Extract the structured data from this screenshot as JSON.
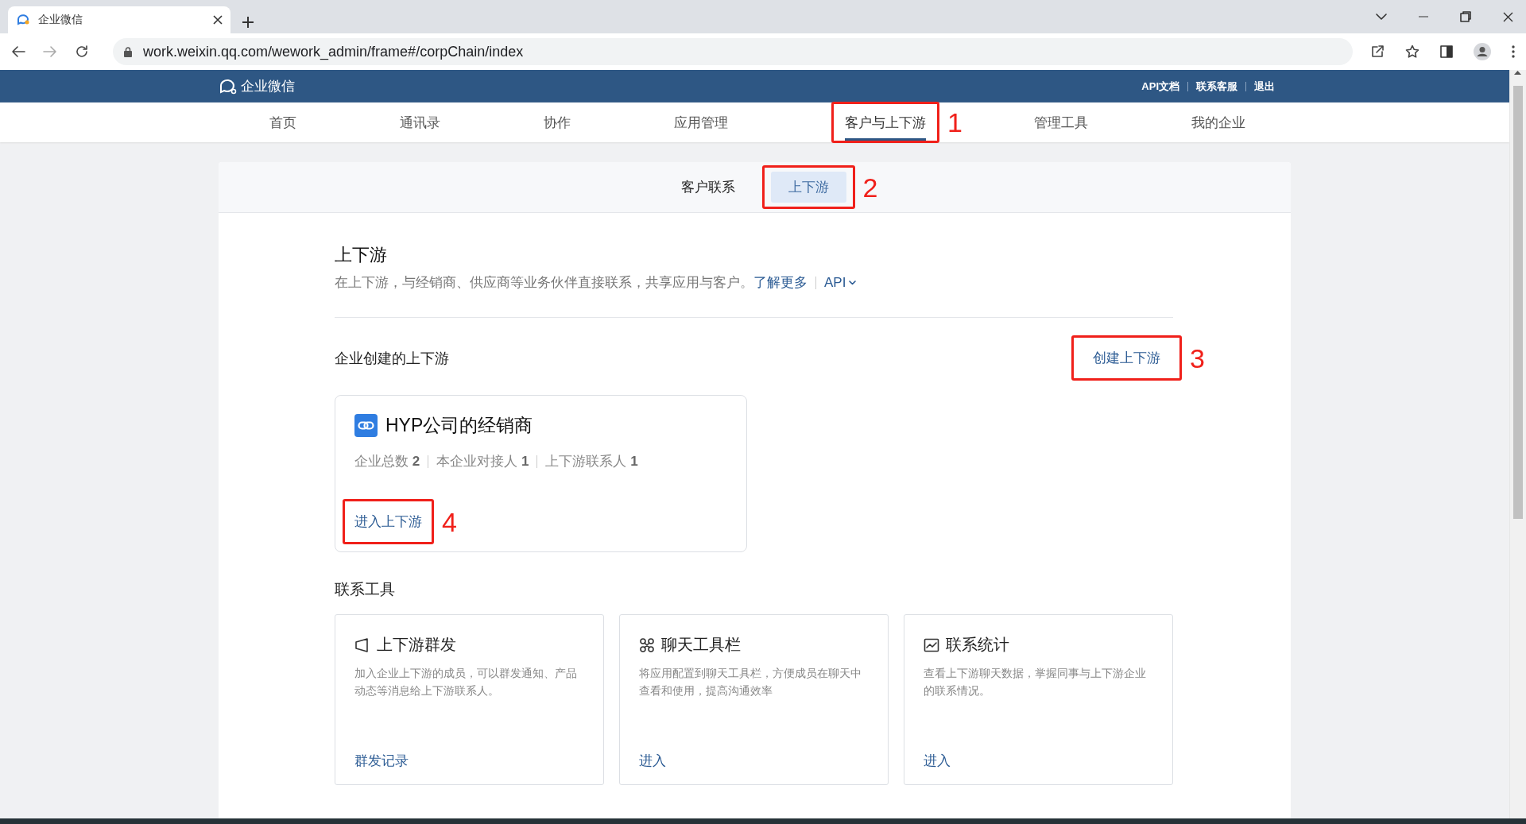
{
  "browser": {
    "tab_title": "企业微信",
    "url": "work.weixin.qq.com/wework_admin/frame#/corpChain/index"
  },
  "header": {
    "logo": "企业微信",
    "links": [
      "API文档",
      "联系客服",
      "退出"
    ]
  },
  "nav": [
    {
      "label": "首页",
      "selected": false
    },
    {
      "label": "通讯录",
      "selected": false
    },
    {
      "label": "协作",
      "selected": false
    },
    {
      "label": "应用管理",
      "selected": false
    },
    {
      "label": "客户与上下游",
      "selected": true,
      "annotation": "1"
    },
    {
      "label": "管理工具",
      "selected": false
    },
    {
      "label": "我的企业",
      "selected": false
    }
  ],
  "subtabs": [
    {
      "label": "客户联系",
      "selected": false
    },
    {
      "label": "上下游",
      "selected": true,
      "annotation": "2"
    }
  ],
  "intro": {
    "title": "上下游",
    "description": "在上下游，与经销商、供应商等业务伙伴直接联系，共享应用与客户。",
    "learn_more": "了解更多",
    "api": "API"
  },
  "created": {
    "title": "企业创建的上下游",
    "create_button": {
      "label": "创建上下游",
      "annotation": "3"
    }
  },
  "chain_card": {
    "name": "HYP公司的经销商",
    "stats": [
      {
        "label": "企业总数",
        "value": "2"
      },
      {
        "label": "本企业对接人",
        "value": "1"
      },
      {
        "label": "上下游联系人",
        "value": "1"
      }
    ],
    "enter_link": {
      "label": "进入上下游",
      "annotation": "4"
    }
  },
  "tools": {
    "title": "联系工具",
    "cards": [
      {
        "kind": "broadcast",
        "title": "上下游群发",
        "description": "加入企业上下游的成员，可以群发通知、产品动态等消息给上下游联系人。",
        "link": "群发记录"
      },
      {
        "kind": "toolbar",
        "title": "聊天工具栏",
        "description": "将应用配置到聊天工具栏，方便成员在聊天中查看和使用，提高沟通效率",
        "link": "进入"
      },
      {
        "kind": "stats",
        "title": "联系统计",
        "description": "查看上下游聊天数据，掌握同事与上下游企业的联系情况。",
        "link": "进入"
      }
    ]
  }
}
